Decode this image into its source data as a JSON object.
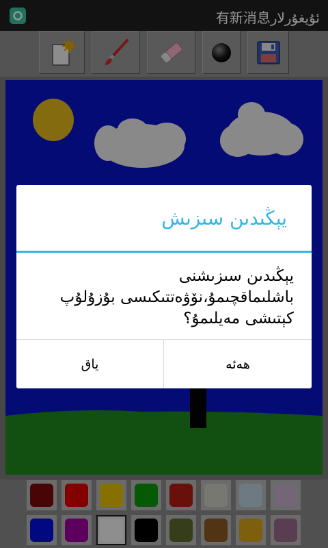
{
  "status_bar": {
    "notification_text": "有新消息ئۇيغۇرلار"
  },
  "toolbar": {
    "tools": [
      {
        "name": "new-page",
        "icon": "new-page-icon"
      },
      {
        "name": "brush",
        "icon": "brush-icon"
      },
      {
        "name": "eraser",
        "icon": "eraser-icon"
      },
      {
        "name": "brush-size",
        "icon": "brush-size-icon"
      },
      {
        "name": "save",
        "icon": "save-icon"
      }
    ]
  },
  "canvas": {
    "sky_color": "#0a14c8",
    "grass_color": "#1f8a1f",
    "sun_color": "#e6b81a",
    "cloud_color": "#ececec"
  },
  "palette": {
    "row1": [
      {
        "name": "dark-red",
        "color": "#7a0a0a"
      },
      {
        "name": "red",
        "color": "#e00000"
      },
      {
        "name": "yellow",
        "color": "#e6c200"
      },
      {
        "name": "green",
        "color": "#0a9a0a"
      },
      {
        "name": "red-texture",
        "color": "#b41e14"
      },
      {
        "name": "stone-texture",
        "color": "#cfcfc4"
      },
      {
        "name": "cloud-texture",
        "color": "#bcd2e0"
      },
      {
        "name": "confetti-texture",
        "color": "#c6b0cc"
      }
    ],
    "row2": [
      {
        "name": "blue",
        "color": "#0010e0"
      },
      {
        "name": "purple",
        "color": "#a000a0"
      },
      {
        "name": "white",
        "color": "#f4f4f4"
      },
      {
        "name": "black",
        "color": "#000000"
      },
      {
        "name": "moss-texture",
        "color": "#5c6a2e"
      },
      {
        "name": "bark-texture",
        "color": "#8a5a22"
      },
      {
        "name": "gold-texture",
        "color": "#d9a418"
      },
      {
        "name": "purple-texture",
        "color": "#9a6a8a"
      }
    ],
    "selected": "white"
  },
  "dialog": {
    "title": "يېڭىدىن سىزىش",
    "message": "يېڭىدىن سىزىشنى باشلىماقچىمۇ،نۆۋەتتىكىسى بۇزۇلۇپ كېتىشى مەيلىمۇ؟",
    "positive_label": "ھەئە",
    "negative_label": "ياق",
    "accent_color": "#33b5e5"
  }
}
